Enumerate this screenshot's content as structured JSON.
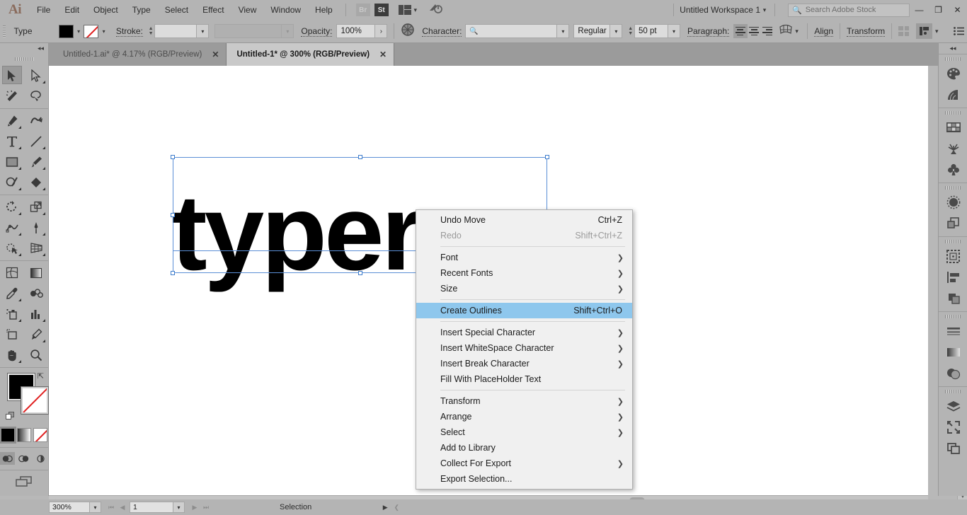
{
  "app": {
    "logo": "Ai",
    "menus": [
      "File",
      "Edit",
      "Object",
      "Type",
      "Select",
      "Effect",
      "View",
      "Window",
      "Help"
    ],
    "bridge_label": "Br",
    "stock_label": "St",
    "workspace": "Untitled Workspace 1",
    "search_placeholder": "Search Adobe Stock",
    "window_buttons": {
      "minimize": "—",
      "restore": "❐",
      "close": "✕"
    }
  },
  "controlbar": {
    "tool_label": "Type",
    "fill_color": "#000000",
    "stroke_color": "none",
    "stroke_label": "Stroke:",
    "stroke_weight": "",
    "stroke_profile": "",
    "opacity_label": "Opacity:",
    "opacity_value": "100%",
    "character_label": "Character:",
    "font_family": "",
    "font_style": "Regular",
    "font_size": "50 pt",
    "paragraph_label": "Paragraph:",
    "align_label": "Align",
    "transform_label": "Transform",
    "accent": "#8ec7ed"
  },
  "tabs": [
    {
      "title": "Untitled-1.ai* @ 4.17% (RGB/Preview)",
      "active": false,
      "close": "✕"
    },
    {
      "title": "Untitled-1* @ 300% (RGB/Preview)",
      "active": true,
      "close": "✕"
    }
  ],
  "toolbar": {
    "collapse": "◂◂",
    "tools": [
      [
        {
          "name": "selection-tool",
          "selected": true,
          "corner": false
        },
        {
          "name": "direct-selection-tool",
          "selected": false,
          "corner": true
        }
      ],
      [
        {
          "name": "magic-wand-tool",
          "selected": false,
          "corner": false
        },
        {
          "name": "lasso-tool",
          "selected": false,
          "corner": false
        }
      ],
      [
        {
          "name": "pen-tool",
          "selected": false,
          "corner": true
        },
        {
          "name": "curvature-tool",
          "selected": false,
          "corner": false
        }
      ],
      [
        {
          "name": "type-tool",
          "selected": false,
          "corner": true
        },
        {
          "name": "line-segment-tool",
          "selected": false,
          "corner": true
        }
      ],
      [
        {
          "name": "rectangle-tool",
          "selected": false,
          "corner": true
        },
        {
          "name": "paintbrush-tool",
          "selected": false,
          "corner": true
        }
      ],
      [
        {
          "name": "shaper-tool",
          "selected": false,
          "corner": true
        },
        {
          "name": "eraser-tool",
          "selected": false,
          "corner": true
        }
      ],
      [
        {
          "name": "rotate-tool",
          "selected": false,
          "corner": true
        },
        {
          "name": "scale-tool",
          "selected": false,
          "corner": true
        }
      ],
      [
        {
          "name": "width-tool",
          "selected": false,
          "corner": true
        },
        {
          "name": "free-transform-tool",
          "selected": false,
          "corner": true
        }
      ],
      [
        {
          "name": "shape-builder-tool",
          "selected": false,
          "corner": true
        },
        {
          "name": "perspective-grid-tool",
          "selected": false,
          "corner": true
        }
      ],
      [
        {
          "name": "mesh-tool",
          "selected": false,
          "corner": false
        },
        {
          "name": "gradient-tool",
          "selected": false,
          "corner": false
        }
      ],
      [
        {
          "name": "eyedropper-tool",
          "selected": false,
          "corner": true
        },
        {
          "name": "blend-tool",
          "selected": false,
          "corner": false
        }
      ],
      [
        {
          "name": "symbol-sprayer-tool",
          "selected": false,
          "corner": true
        },
        {
          "name": "column-graph-tool",
          "selected": false,
          "corner": true
        }
      ],
      [
        {
          "name": "artboard-tool",
          "selected": false,
          "corner": false
        },
        {
          "name": "slice-tool",
          "selected": false,
          "corner": true
        }
      ],
      [
        {
          "name": "hand-tool",
          "selected": false,
          "corner": true
        },
        {
          "name": "zoom-tool",
          "selected": false,
          "corner": false
        }
      ]
    ],
    "fill_color": "#000000",
    "stroke_color": "none",
    "color_modes": [
      "color",
      "gradient",
      "none"
    ],
    "draw_modes": [
      "draw-normal",
      "draw-behind",
      "draw-inside"
    ],
    "screen_mode": "change-screen-mode"
  },
  "canvas": {
    "artwork_text": "typerx",
    "selection_color": "#5b8fd6"
  },
  "context_menu": {
    "items": [
      {
        "label": "Undo Move",
        "accel": "Ctrl+Z",
        "disabled": false,
        "submenu": false,
        "highlight": false
      },
      {
        "label": "Redo",
        "accel": "Shift+Ctrl+Z",
        "disabled": true,
        "submenu": false,
        "highlight": false
      },
      {
        "separator": true
      },
      {
        "label": "Font",
        "accel": "",
        "disabled": false,
        "submenu": true,
        "highlight": false
      },
      {
        "label": "Recent Fonts",
        "accel": "",
        "disabled": false,
        "submenu": true,
        "highlight": false
      },
      {
        "label": "Size",
        "accel": "",
        "disabled": false,
        "submenu": true,
        "highlight": false
      },
      {
        "separator": true
      },
      {
        "label": "Create Outlines",
        "accel": "Shift+Ctrl+O",
        "disabled": false,
        "submenu": false,
        "highlight": true
      },
      {
        "separator": true
      },
      {
        "label": "Insert Special Character",
        "accel": "",
        "disabled": false,
        "submenu": true,
        "highlight": false
      },
      {
        "label": "Insert WhiteSpace Character",
        "accel": "",
        "disabled": false,
        "submenu": true,
        "highlight": false
      },
      {
        "label": "Insert Break Character",
        "accel": "",
        "disabled": false,
        "submenu": true,
        "highlight": false
      },
      {
        "label": "Fill With PlaceHolder Text",
        "accel": "",
        "disabled": false,
        "submenu": false,
        "highlight": false
      },
      {
        "separator": true
      },
      {
        "label": "Transform",
        "accel": "",
        "disabled": false,
        "submenu": true,
        "highlight": false
      },
      {
        "label": "Arrange",
        "accel": "",
        "disabled": false,
        "submenu": true,
        "highlight": false
      },
      {
        "label": "Select",
        "accel": "",
        "disabled": false,
        "submenu": true,
        "highlight": false
      },
      {
        "label": "Add to Library",
        "accel": "",
        "disabled": false,
        "submenu": false,
        "highlight": false
      },
      {
        "label": "Collect For Export",
        "accel": "",
        "disabled": false,
        "submenu": true,
        "highlight": false
      },
      {
        "label": "Export Selection...",
        "accel": "",
        "disabled": false,
        "submenu": false,
        "highlight": false
      }
    ]
  },
  "statusbar": {
    "zoom": "300%",
    "page": "1",
    "status": "Selection"
  },
  "rightdock": {
    "collapse": "◂◂",
    "groups": [
      [
        "color-panel-icon",
        "color-guide-panel-icon"
      ],
      [
        "swatches-panel-icon",
        "brushes-panel-icon",
        "symbols-panel-icon"
      ],
      [
        "appearance-panel-icon",
        "graphic-styles-panel-icon"
      ],
      [
        "artboards-panel-icon",
        "align-panel-icon",
        "pathfinder-panel-icon"
      ],
      [
        "stroke-panel-icon",
        "gradient-panel-icon",
        "transparency-panel-icon"
      ],
      [
        "layers-panel-icon",
        "asset-export-panel-icon",
        "links-panel-icon"
      ]
    ]
  }
}
